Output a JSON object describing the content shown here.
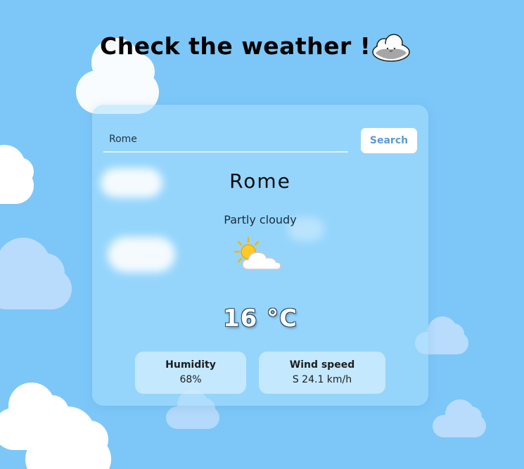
{
  "header": {
    "title": "Check the weather !",
    "mascot_icon": "cloud-mascot-icon"
  },
  "search": {
    "value": "Rome",
    "button_label": "Search"
  },
  "weather": {
    "city": "Rome",
    "condition": "Partly cloudy",
    "condition_icon": "partly-cloudy-icon",
    "temperature": "16 °C"
  },
  "stats": {
    "humidity_label": "Humidity",
    "humidity_value": "68%",
    "wind_label": "Wind speed",
    "wind_value": "S 24.1 km/h"
  },
  "colors": {
    "background": "#7cc7f8",
    "card": "#aae0ff",
    "button_text": "#5a9ad4"
  }
}
